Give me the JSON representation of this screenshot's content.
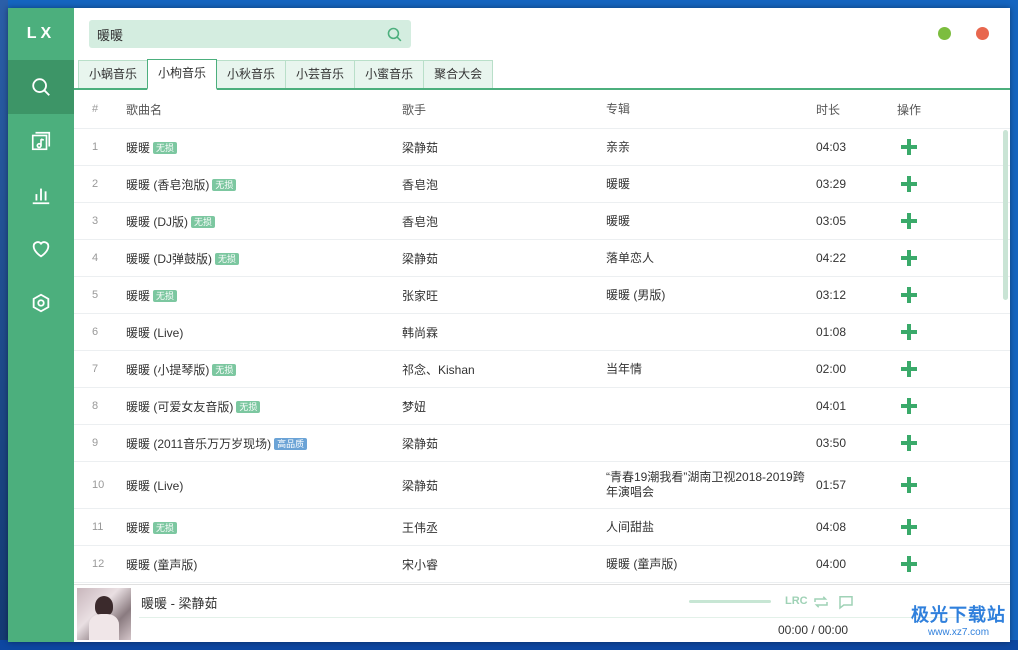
{
  "app": {
    "logo": "LX"
  },
  "search": {
    "value": "暖暖"
  },
  "tabs": [
    {
      "label": "小蜗音乐"
    },
    {
      "label": "小枸音乐"
    },
    {
      "label": "小秋音乐"
    },
    {
      "label": "小芸音乐"
    },
    {
      "label": "小蜜音乐"
    },
    {
      "label": "聚合大会"
    }
  ],
  "table": {
    "headers": {
      "idx": "#",
      "name": "歌曲名",
      "artist": "歌手",
      "album": "专辑",
      "duration": "时长",
      "op": "操作"
    },
    "rows": [
      {
        "idx": "1",
        "name": "暖暖",
        "badge": "无损",
        "artist": "梁静茹",
        "album": "亲亲",
        "duration": "04:03"
      },
      {
        "idx": "2",
        "name": "暖暖 (香皂泡版)",
        "badge": "无损",
        "artist": "香皂泡",
        "album": "暖暖",
        "duration": "03:29"
      },
      {
        "idx": "3",
        "name": "暖暖 (DJ版)",
        "badge": "无损",
        "artist": "香皂泡",
        "album": "暖暖",
        "duration": "03:05"
      },
      {
        "idx": "4",
        "name": "暖暖 (DJ弹鼓版)",
        "badge": "无损",
        "artist": "梁静茹",
        "album": "落单恋人",
        "duration": "04:22"
      },
      {
        "idx": "5",
        "name": "暖暖",
        "badge": "无损",
        "artist": "张家旺",
        "album": "暖暖 (男版)",
        "duration": "03:12"
      },
      {
        "idx": "6",
        "name": "暖暖 (Live)",
        "badge": "",
        "artist": "韩尚霖",
        "album": "",
        "duration": "01:08"
      },
      {
        "idx": "7",
        "name": "暖暖 (小提琴版)",
        "badge": "无损",
        "artist": "祁念、Kishan",
        "album": "当年情",
        "duration": "02:00"
      },
      {
        "idx": "8",
        "name": "暖暖 (可爱女友音版)",
        "badge": "无损",
        "artist": "梦妞",
        "album": "",
        "duration": "04:01"
      },
      {
        "idx": "9",
        "name": "暖暖 (2011音乐万万岁现场)",
        "badge": "高品质",
        "artist": "梁静茹",
        "album": "",
        "duration": "03:50"
      },
      {
        "idx": "10",
        "name": "暖暖 (Live)",
        "badge": "",
        "artist": "梁静茹",
        "album": "“青春19潮我看”湖南卫视2018-2019跨年演唱会",
        "duration": "01:57"
      },
      {
        "idx": "11",
        "name": "暖暖",
        "badge": "无损",
        "artist": "王伟丞",
        "album": "人间甜盐",
        "duration": "04:08"
      },
      {
        "idx": "12",
        "name": "暖暖 (童声版)",
        "badge": "",
        "artist": "宋小睿",
        "album": "暖暖 (童声版)",
        "duration": "04:00"
      }
    ]
  },
  "player": {
    "title": "暖暖 - 梁静茹",
    "lrc_label": "LRC",
    "current_time": "00:00",
    "separator": "/",
    "total_time": "00:00"
  },
  "watermark": {
    "main": "极光下载站",
    "sub": "www.xz7.com"
  },
  "colors": {
    "accent": "#4caf7d",
    "sidebar_active": "#3d9567",
    "search_bg": "#d4ede0",
    "min": "#7cbd3e",
    "close": "#e8674e"
  },
  "icons": [
    "search-icon",
    "music-list-icon",
    "chart-icon",
    "heart-icon",
    "settings-icon",
    "plus-icon",
    "repeat-icon",
    "comment-icon"
  ]
}
